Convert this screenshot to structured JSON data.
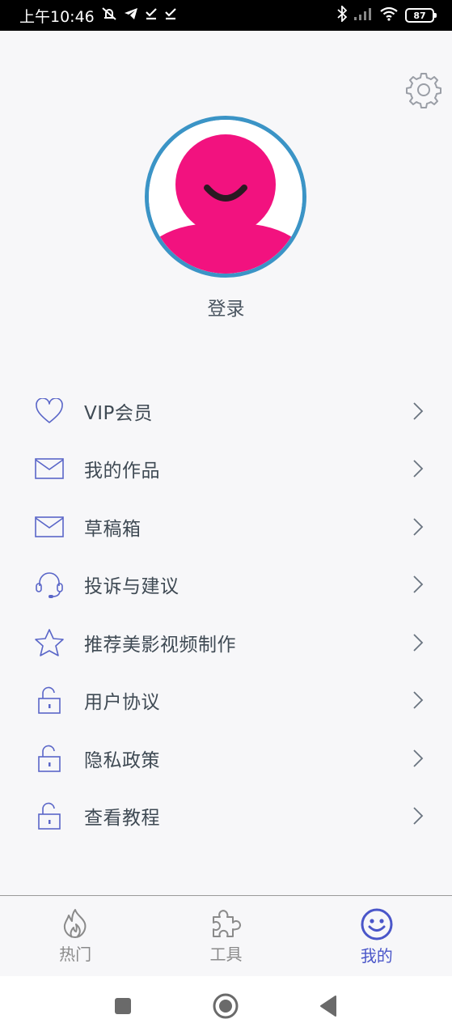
{
  "status_bar": {
    "time": "上午10:46",
    "battery": "87"
  },
  "profile": {
    "login_label": "登录"
  },
  "menu": {
    "items": [
      {
        "label": "VIP会员",
        "icon": "heart-icon"
      },
      {
        "label": "我的作品",
        "icon": "envelope-icon"
      },
      {
        "label": "草稿箱",
        "icon": "envelope-icon"
      },
      {
        "label": "投诉与建议",
        "icon": "headset-icon"
      },
      {
        "label": "推荐美影视频制作",
        "icon": "star-icon"
      },
      {
        "label": "用户协议",
        "icon": "unlock-icon"
      },
      {
        "label": "隐私政策",
        "icon": "unlock-icon"
      },
      {
        "label": "查看教程",
        "icon": "unlock-icon"
      }
    ]
  },
  "tabs": [
    {
      "label": "热门",
      "icon": "flame-icon",
      "active": false
    },
    {
      "label": "工具",
      "icon": "puzzle-icon",
      "active": false
    },
    {
      "label": "我的",
      "icon": "smiley-icon",
      "active": true
    }
  ],
  "colors": {
    "accent": "#4a56c9",
    "icon_blue": "#5a66c8",
    "avatar_pink": "#f2127f",
    "avatar_ring": "#3b94c6"
  }
}
